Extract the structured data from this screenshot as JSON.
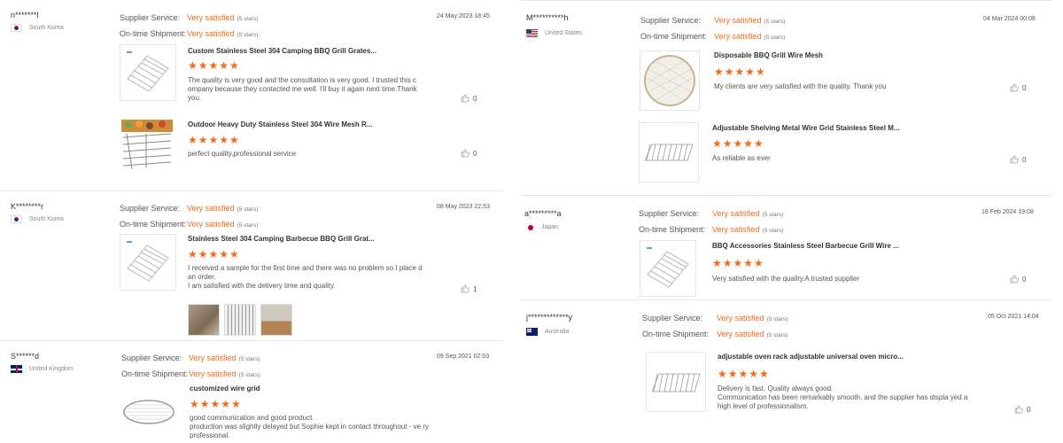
{
  "labels": {
    "supplier_service": "Supplier Service:",
    "ontime_shipment": "On-time Shipment:"
  },
  "left": [
    {
      "user": "n*******l",
      "country": "South Korea",
      "date": "24 May 2023 18:45",
      "supplier_service": "Very satisfied",
      "supplier_service_note": "(5 stars)",
      "ontime_shipment": "Very satisfied",
      "ontime_shipment_note": "(5 stars)",
      "items": [
        {
          "title": "Custom Stainless Steel 304 Camping BBQ Grill Grates...",
          "stars": "★★★★★",
          "comment": "The quality is very good and the consultation is very good. I trusted this c ompany because they contacted me well. I'll buy it again next time.Thank you.",
          "likes": "0"
        },
        {
          "title": "Outdoor Heavy Duty Stainless Steel 304 Wire Mesh R...",
          "stars": "★★★★★",
          "comment": "perfect quality,professional service",
          "likes": "0"
        }
      ]
    },
    {
      "user": "K********r",
      "country": "South Korea",
      "date": "08 May 2023 22:53",
      "supplier_service": "Very satisfied",
      "supplier_service_note": "(5 stars)",
      "ontime_shipment": "Very satisfied",
      "ontime_shipment_note": "(5 stars)",
      "items": [
        {
          "title": "Stainless Steel 304 Camping Barbecue BBQ Grill Grat...",
          "stars": "★★★★★",
          "comment": "I received a sample for the first time and there was no problem so I place d an order.\nI am satisfied with the delivery time and quality.",
          "likes": "1"
        }
      ]
    },
    {
      "user": "S******d",
      "country": "United Kingdom",
      "date": "09 Sep 2021 02:03",
      "supplier_service": "Very satisfied",
      "supplier_service_note": "(5 stars)",
      "ontime_shipment": "Very satisfied",
      "ontime_shipment_note": "(5 stars)",
      "items": [
        {
          "title": "customized wire grid",
          "stars": "★★★★★",
          "comment": "good communication and good product.\nproduction was slightly delayed but Sophie kept in contact throughout - ve ry professional.",
          "likes": ""
        }
      ]
    }
  ],
  "right": [
    {
      "user": "M**********h",
      "country": "United States",
      "date": "04 Mar 2024 00:08",
      "supplier_service": "Very satisfied",
      "supplier_service_note": "(5 stars)",
      "ontime_shipment": "Very satisfied",
      "ontime_shipment_note": "(5 stars)",
      "items": [
        {
          "title": "Disposable BBQ Grill Wire Mesh",
          "stars": "★★★★★",
          "comment": "My clients are very satisfied with the quality. Thank you",
          "likes": "0"
        },
        {
          "title": "Adjustable Shelving Metal Wire Grid Stainless Steel M...",
          "stars": "★★★★★",
          "comment": "As reliable as ever",
          "likes": "0"
        }
      ]
    },
    {
      "user": "a*********a",
      "country": "Japan",
      "date": "18 Feb 2024 19:08",
      "supplier_service": "Very satisfied",
      "supplier_service_note": "(5 stars)",
      "ontime_shipment": "Very satisfied",
      "ontime_shipment_note": "(5 stars)",
      "items": [
        {
          "title": "BBQ Accessories Stainless Steel Barbecue Grill Wire ...",
          "stars": "★★★★★",
          "comment": "Very satisfied with the quality.A trusted supplier",
          "likes": "0"
        }
      ]
    },
    {
      "user": "j*************y",
      "country": "Australia",
      "date": "05 Oct 2021 14:04",
      "supplier_service": "Very satisfied",
      "supplier_service_note": "(5 stars)",
      "ontime_shipment": "Very satisfied",
      "ontime_shipment_note": "(5 stars)",
      "items": [
        {
          "title": "adjustable oven rack adjustable universal oven micro...",
          "stars": "★★★★★",
          "comment": "Delivery is fast. Quality always good.\nCommunication has been remarkably smooth, and the supplier has displa yed a high level of professionalism.",
          "likes": "0"
        }
      ]
    }
  ]
}
